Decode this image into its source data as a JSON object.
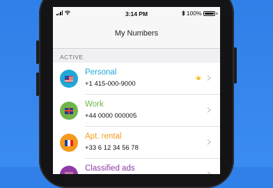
{
  "status_bar": {
    "time": "3:14 PM",
    "battery": "100%"
  },
  "nav": {
    "title": "My Numbers"
  },
  "section": {
    "header": "ACTIVE"
  },
  "colors": {
    "personal": "#1fa8d8",
    "work": "#72b44a",
    "apt": "#f39a1c",
    "classified": "#8f3aa8"
  },
  "lines": [
    {
      "name": "Personal",
      "number": "+1 415-000-9000",
      "flag": "us-flag-icon"
    },
    {
      "name": "Work",
      "number": "+44 0000 000005",
      "flag": "uk-flag-icon"
    },
    {
      "name": "Apt. rental",
      "number": "+33 6 12 34 56 78",
      "flag": "france-flag-icon"
    },
    {
      "name": "Classified ads",
      "number": "",
      "flag": "flag-icon"
    }
  ]
}
